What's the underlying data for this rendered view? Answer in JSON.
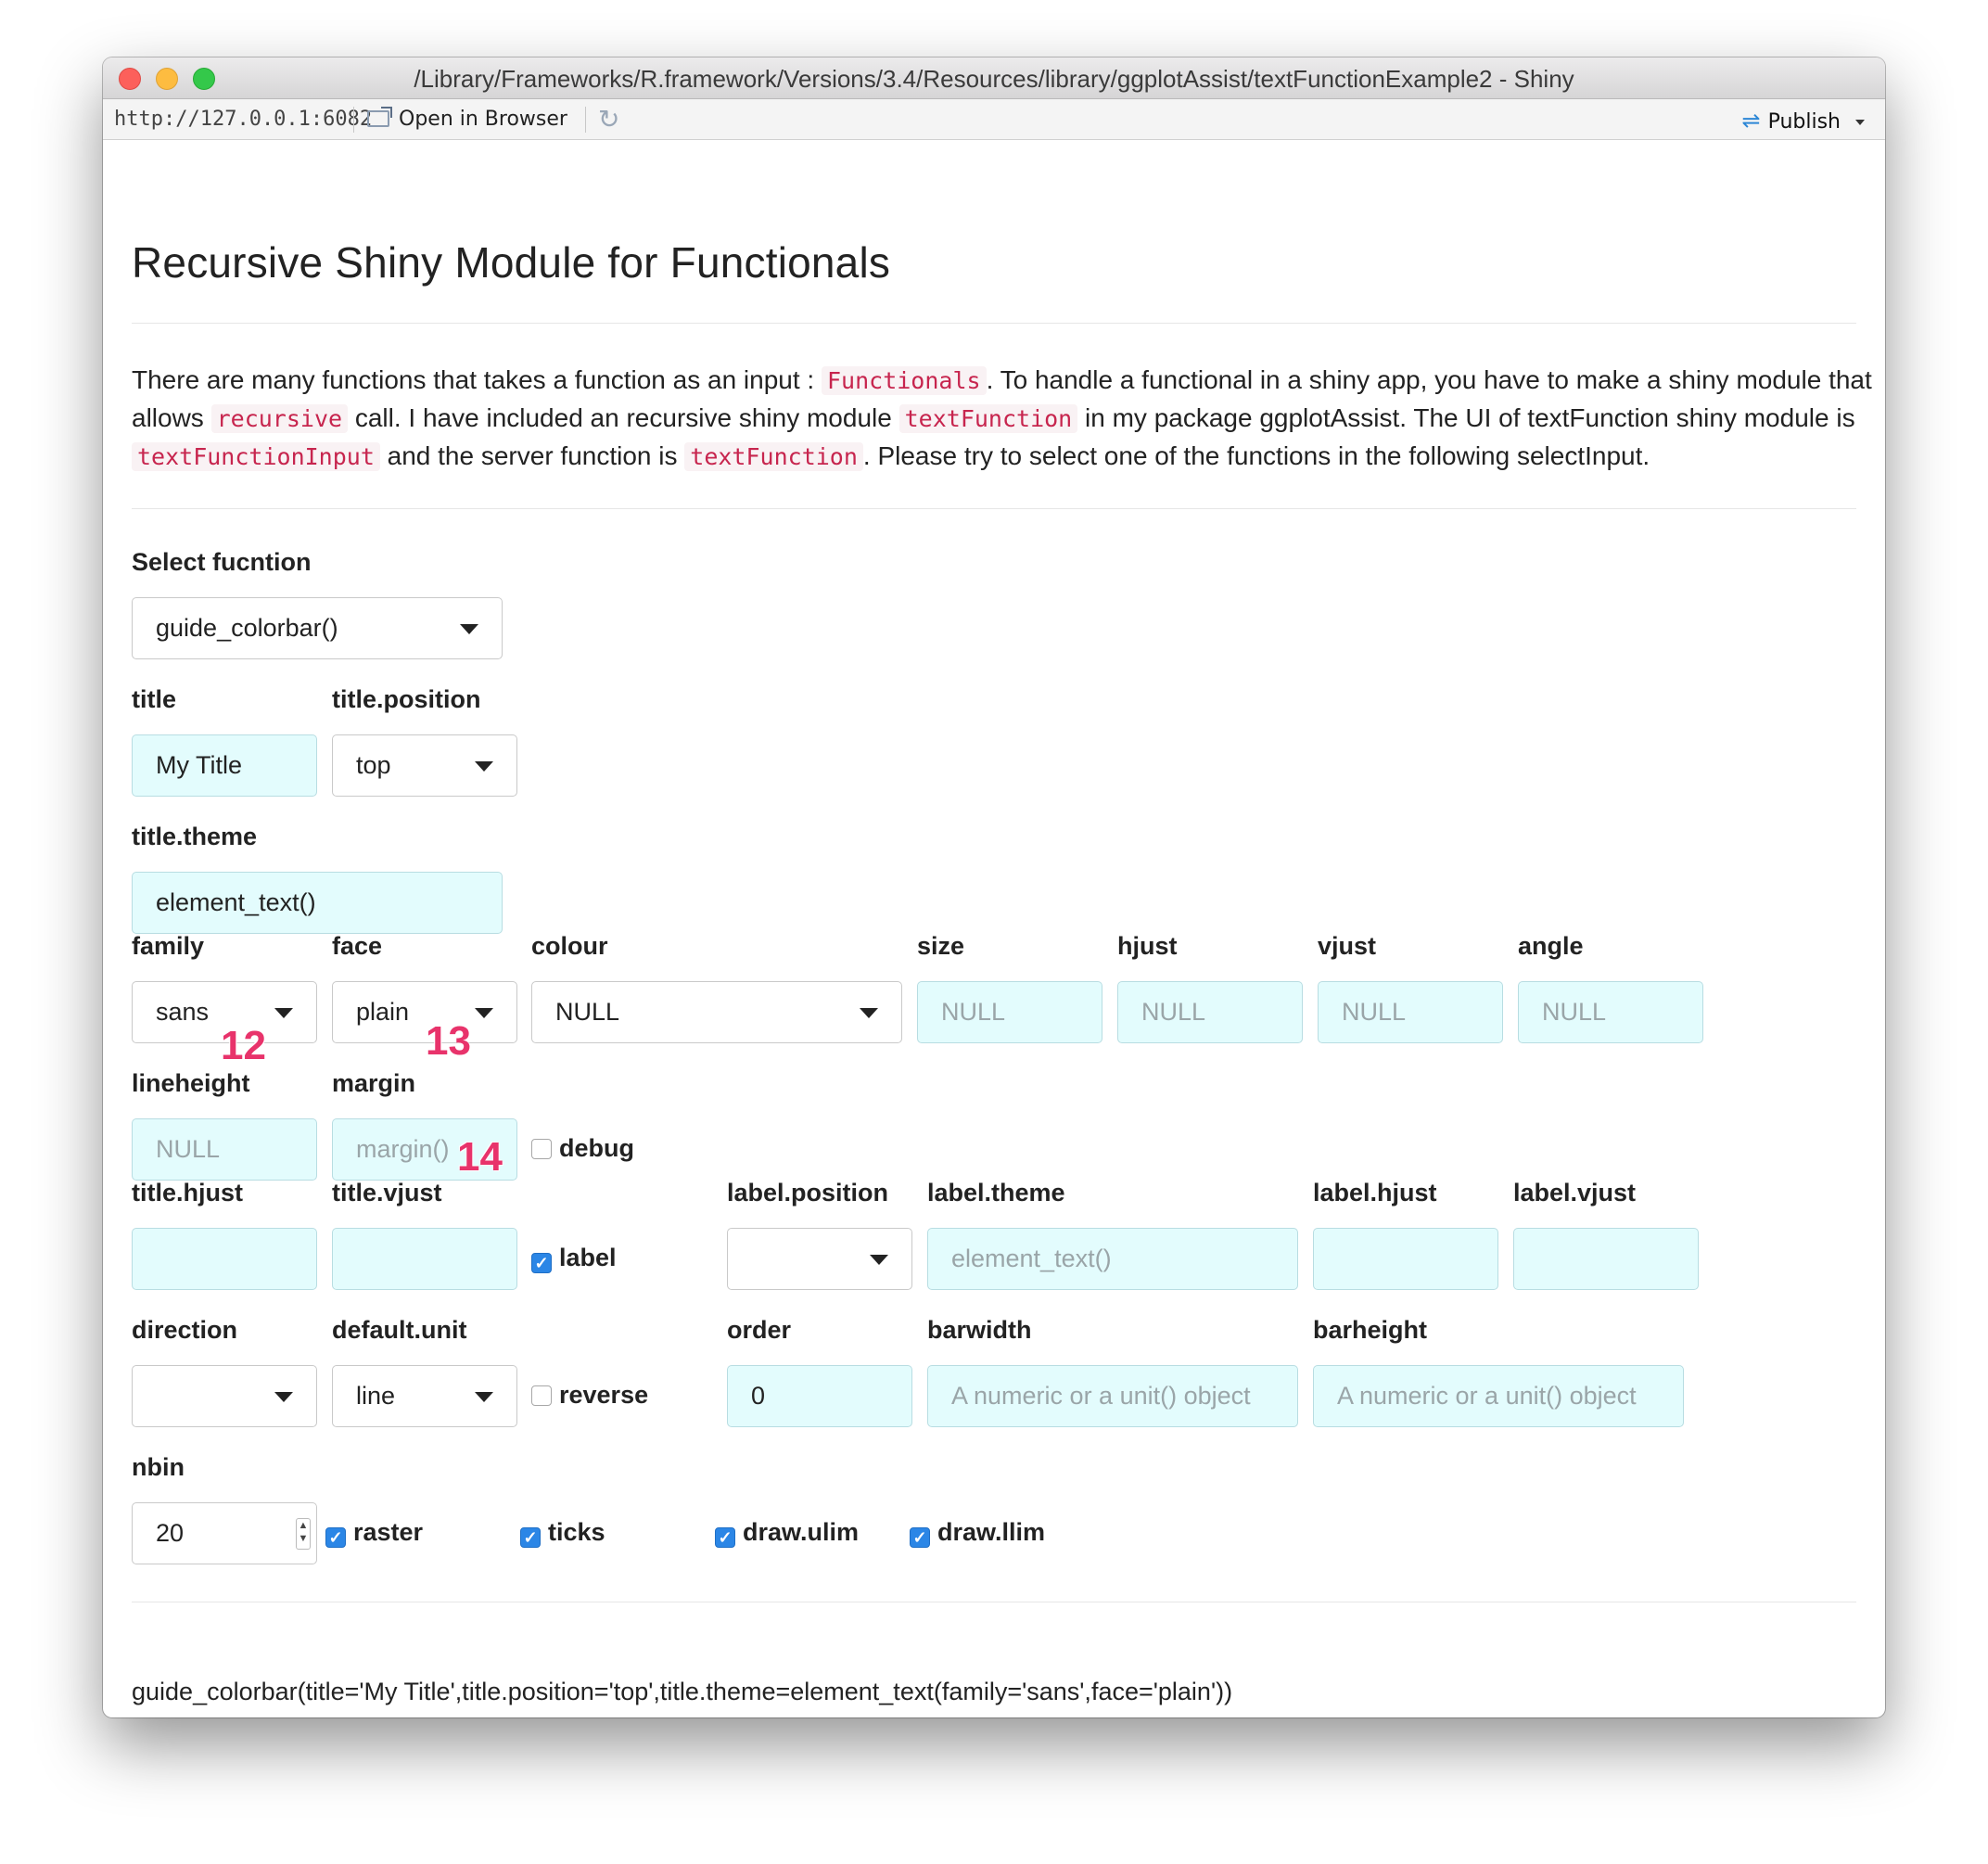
{
  "window": {
    "title": "/Library/Frameworks/R.framework/Versions/3.4/Resources/library/ggplotAssist/textFunctionExample2 - Shiny"
  },
  "toolbar": {
    "url": "http://127.0.0.1:6082",
    "open_in_browser": "Open in Browser",
    "publish": "Publish",
    "icons": [
      "open-browser-icon",
      "refresh-icon",
      "publish-icon"
    ]
  },
  "page": {
    "title": "Recursive Shiny Module for Functionals",
    "intro": [
      {
        "t": "There are many functions that takes a function as an input : "
      },
      {
        "c": "Functionals"
      },
      {
        "t": ". To handle a functional in a shiny app, you have to make a shiny module that allows "
      },
      {
        "c": "recursive"
      },
      {
        "t": " call. I have included an recursive shiny module "
      },
      {
        "c": "textFunction"
      },
      {
        "t": " in my package ggplotAssist. The UI of textFunction shiny module is "
      },
      {
        "c": "textFunctionInput"
      },
      {
        "t": " and the server function is "
      },
      {
        "c": "textFunction"
      },
      {
        "t": ". Please try to select one of the functions in the following selectInput."
      }
    ]
  },
  "form": {
    "select_label": "Select fucntion",
    "select_value": "guide_colorbar()",
    "title": {
      "label": "title",
      "value": "My Title"
    },
    "title_position": {
      "label": "title.position",
      "value": "top"
    },
    "title_theme": {
      "label": "title.theme",
      "value": "element_text()"
    },
    "family": {
      "label": "family",
      "value": "sans"
    },
    "face": {
      "label": "face",
      "value": "plain"
    },
    "colour": {
      "label": "colour",
      "value": "NULL"
    },
    "size": {
      "label": "size",
      "placeholder": "NULL"
    },
    "hjust": {
      "label": "hjust",
      "placeholder": "NULL"
    },
    "vjust": {
      "label": "vjust",
      "placeholder": "NULL"
    },
    "angle": {
      "label": "angle",
      "placeholder": "NULL"
    },
    "lineheight": {
      "label": "lineheight",
      "placeholder": "NULL"
    },
    "margin": {
      "label": "margin",
      "placeholder": "margin()"
    },
    "debug": {
      "label": "debug",
      "checked": false
    },
    "title_hjust": {
      "label": "title.hjust",
      "value": ""
    },
    "title_vjust": {
      "label": "title.vjust",
      "value": ""
    },
    "label": {
      "label": "label",
      "checked": true
    },
    "label_position": {
      "label": "label.position",
      "value": ""
    },
    "label_theme": {
      "label": "label.theme",
      "placeholder": "element_text()"
    },
    "label_hjust": {
      "label": "label.hjust",
      "value": ""
    },
    "label_vjust": {
      "label": "label.vjust",
      "value": ""
    },
    "direction": {
      "label": "direction",
      "value": ""
    },
    "default_unit": {
      "label": "default.unit",
      "value": "line"
    },
    "reverse": {
      "label": "reverse",
      "checked": false
    },
    "order": {
      "label": "order",
      "value": "0"
    },
    "barwidth": {
      "label": "barwidth",
      "placeholder": "A numeric or a unit() object"
    },
    "barheight": {
      "label": "barheight",
      "placeholder": "A numeric or a unit() object"
    },
    "nbin": {
      "label": "nbin",
      "value": "20"
    },
    "raster": {
      "label": "raster",
      "checked": true
    },
    "ticks": {
      "label": "ticks",
      "checked": true
    },
    "draw_ulim": {
      "label": "draw.ulim",
      "checked": true
    },
    "draw_llim": {
      "label": "draw.llim",
      "checked": true
    }
  },
  "annotations": {
    "a12": "12",
    "a13": "13",
    "a14": "14",
    "color": "#e8336b"
  },
  "output": {
    "code": "guide_colorbar(title='My Title',title.position='top',title.theme=element_text(family='sans',face='plain'))"
  }
}
